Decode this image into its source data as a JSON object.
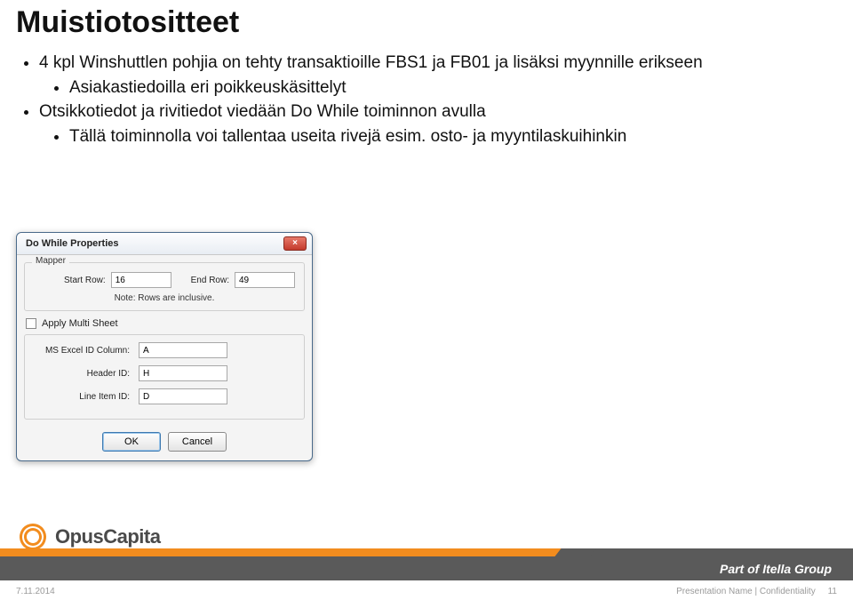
{
  "title": "Muistiotositteet",
  "bullets": {
    "b1": "4 kpl Winshuttlen pohjia on tehty transaktioille FBS1 ja FB01 ja lisäksi myynnille erikseen",
    "b1_1": "Asiakastiedoilla eri poikkeuskäsittelyt",
    "b2": "Otsikkotiedot ja rivitiedot viedään Do While toiminnon avulla",
    "b2_1": "Tällä toiminnolla voi tallentaa useita rivejä esim. osto- ja myyntilaskuihinkin"
  },
  "dialog": {
    "title": "Do While Properties",
    "close": "×",
    "mapper": {
      "legend": "Mapper",
      "start_label": "Start Row:",
      "start_value": "16",
      "end_label": "End Row:",
      "end_value": "49",
      "note": "Note: Rows are inclusive."
    },
    "apply_label": "Apply Multi Sheet",
    "fields": {
      "f1_label": "MS Excel ID Column:",
      "f1_value": "A",
      "f2_label": "Header ID:",
      "f2_value": "H",
      "f3_label": "Line Item ID:",
      "f3_value": "D"
    },
    "buttons": {
      "ok": "OK",
      "cancel": "Cancel"
    }
  },
  "footer": {
    "logo_text": "OpusCapita",
    "tagline": "Part of Itella Group",
    "date": "7.11.2014",
    "meta": "Presentation Name | Confidentiality",
    "page": "11"
  }
}
